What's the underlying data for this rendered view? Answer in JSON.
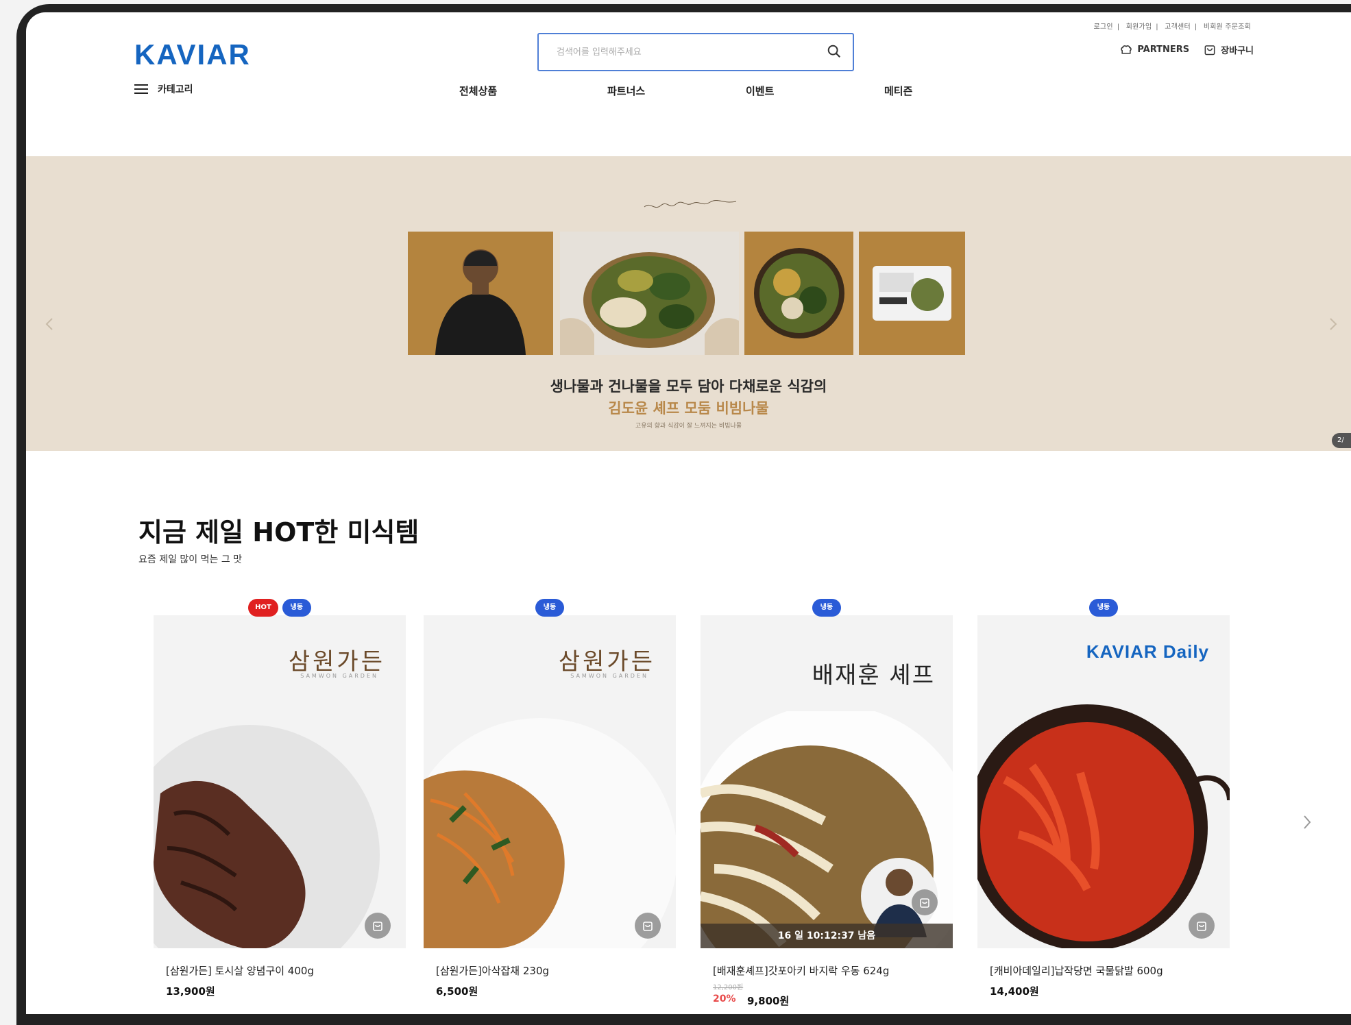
{
  "header": {
    "util_links": [
      "로그인",
      "회원가입",
      "고객센터",
      "비회원 주문조회"
    ],
    "logo": "KAVIAR",
    "search_placeholder": "검색어를 입력해주세요",
    "partners_label": "PARTNERS",
    "cart_label": "장바구니",
    "category_label": "카테고리",
    "nav": [
      "전체상품",
      "파트너스",
      "이벤트",
      "메티즌"
    ]
  },
  "banner": {
    "signature": "Kim Doyoon Chef",
    "line1": "생나물과 건나물을 모두 담아 다채로운 식감의",
    "line2": "김도윤 셰프 모둠 비빔나물",
    "line3": "고유의 향과 식감이 잘 느껴지는 비빔나물",
    "pager": "2/",
    "colors": {
      "background": "#e8ded0",
      "accent": "#b8884a"
    }
  },
  "section": {
    "title": "지금 제일 HOT한 미식템",
    "subtitle": "요즘 제일 많이 먹는 그 맛"
  },
  "products": [
    {
      "badges": [
        "HOT",
        "냉동"
      ],
      "brand": "삼원가든",
      "brand_sub": "SAMWON GARDEN",
      "name": "[삼원가든] 토시살 양념구이 400g",
      "price": "13,900원"
    },
    {
      "badges": [
        "냉동"
      ],
      "brand": "삼원가든",
      "brand_sub": "SAMWON GARDEN",
      "name": "[삼원가든]아삭잡채 230g",
      "price": "6,500원"
    },
    {
      "badges": [
        "냉동"
      ],
      "brand": "배재훈 셰프",
      "name": "[배재훈셰프]갓포아키 바지락 우동 624g",
      "old_price": "12,200원",
      "discount": "20%",
      "price": "9,800원",
      "timer": "16 일 10:12:37 남음"
    },
    {
      "badges": [
        "냉동"
      ],
      "brand": "KAVIAR Daily",
      "name": "[캐비아데일리]납작당면 국물닭발 600g",
      "price": "14,400원"
    }
  ],
  "icons": [
    "search-icon",
    "partners-icon",
    "cart-icon",
    "hamburger-icon",
    "chevron-left-icon",
    "chevron-right-icon"
  ]
}
